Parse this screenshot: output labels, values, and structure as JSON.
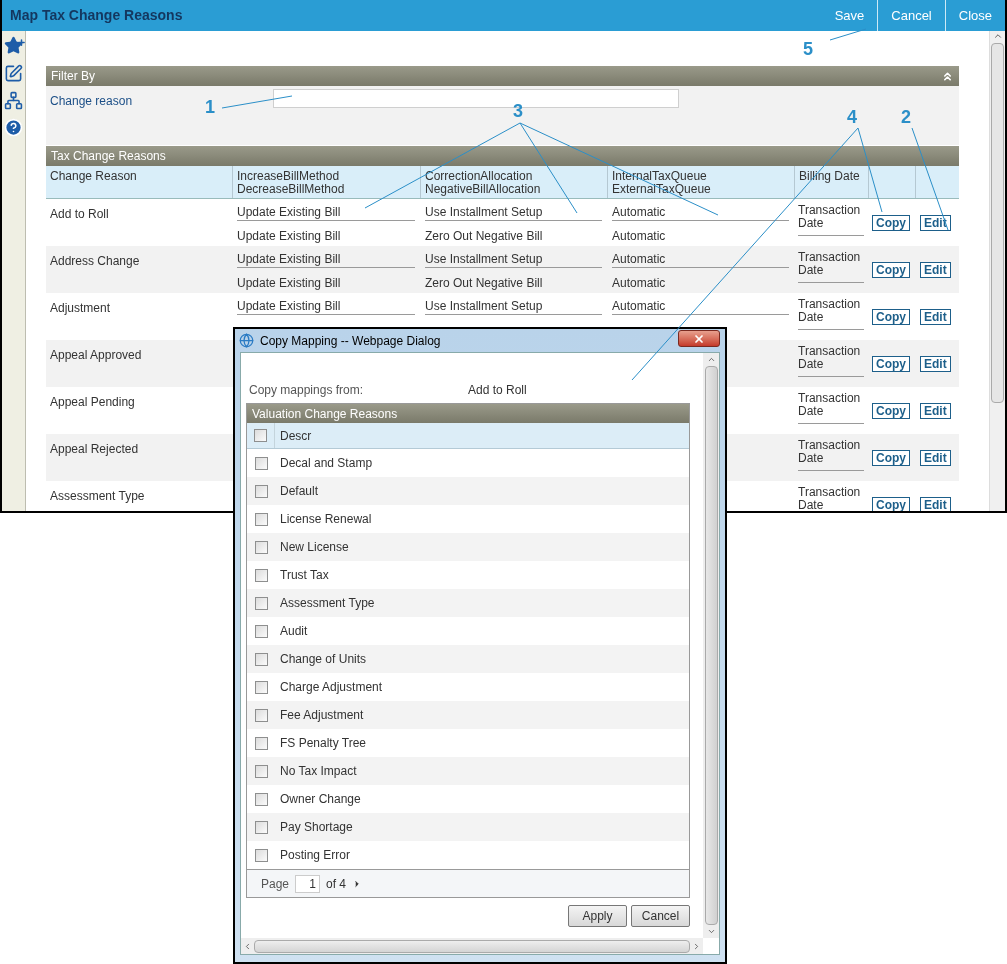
{
  "window": {
    "title": "Map Tax Change Reasons",
    "actions": [
      "Save",
      "Cancel",
      "Close"
    ]
  },
  "filter": {
    "title": "Filter By",
    "label": "Change reason"
  },
  "table": {
    "title": "Tax Change Reasons",
    "columns": [
      [
        "Change Reason"
      ],
      [
        "IncreaseBillMethod",
        "DecreaseBillMethod"
      ],
      [
        "CorrectionAllocation",
        "NegativeBillAllocation"
      ],
      [
        "InternalTaxQueue",
        "ExternalTaxQueue"
      ],
      [
        "Billing Date"
      ]
    ],
    "rows": [
      {
        "reason": "Add to Roll",
        "sub_rows": [
          [
            "Update Existing Bill",
            "Use Installment Setup",
            "Automatic"
          ],
          [
            "Update Existing Bill",
            "Zero Out Negative Bill",
            "Automatic"
          ]
        ],
        "billing_date": "Transaction Date",
        "actions": [
          "Copy",
          "Edit"
        ]
      },
      {
        "reason": "Address Change",
        "sub_rows": [
          [
            "Update Existing Bill",
            "Use Installment Setup",
            "Automatic"
          ],
          [
            "Update Existing Bill",
            "Zero Out Negative Bill",
            "Automatic"
          ]
        ],
        "billing_date": "Transaction Date",
        "actions": [
          "Copy",
          "Edit"
        ]
      },
      {
        "reason": "Adjustment",
        "sub_rows": [
          [
            "Update Existing Bill",
            "Use Installment Setup",
            "Automatic"
          ]
        ],
        "billing_date": "Transaction Date",
        "actions": [
          "Copy",
          "Edit"
        ]
      },
      {
        "reason": "Appeal Approved",
        "billing_date": "Transaction Date",
        "actions": [
          "Copy",
          "Edit"
        ]
      },
      {
        "reason": "Appeal Pending",
        "billing_date": "Transaction Date",
        "actions": [
          "Copy",
          "Edit"
        ]
      },
      {
        "reason": "Appeal Rejected",
        "billing_date": "Transaction Date",
        "actions": [
          "Copy",
          "Edit"
        ]
      },
      {
        "reason": "Assessment Type",
        "billing_date": "Transaction Date",
        "actions": [
          "Copy",
          "Edit"
        ]
      }
    ]
  },
  "dialog": {
    "title": "Copy Mapping -- Webpage Dialog",
    "source_label": "Copy mappings from:",
    "source_value": "Add to Roll",
    "grid": {
      "title": "Valuation Change Reasons",
      "header": {
        "label": "Descr",
        "checked": false
      },
      "items": [
        {
          "label": "Decal and Stamp",
          "checked": false
        },
        {
          "label": "Default",
          "checked": false
        },
        {
          "label": "License Renewal",
          "checked": false
        },
        {
          "label": "New License",
          "checked": false
        },
        {
          "label": "Trust Tax",
          "checked": false
        },
        {
          "label": "Assessment Type",
          "checked": false
        },
        {
          "label": "Audit",
          "checked": false
        },
        {
          "label": "Change of Units",
          "checked": false
        },
        {
          "label": "Charge Adjustment",
          "checked": false
        },
        {
          "label": "Fee Adjustment",
          "checked": false
        },
        {
          "label": "FS Penalty Tree",
          "checked": false
        },
        {
          "label": "No Tax Impact",
          "checked": false
        },
        {
          "label": "Owner Change",
          "checked": false
        },
        {
          "label": "Pay Shortage",
          "checked": false
        },
        {
          "label": "Posting Error",
          "checked": false
        }
      ]
    },
    "pager": {
      "label": "Page",
      "value": "1",
      "total": "of 4"
    },
    "buttons": [
      "Apply",
      "Cancel"
    ]
  },
  "callouts": [
    "1",
    "2",
    "3",
    "4",
    "5"
  ]
}
